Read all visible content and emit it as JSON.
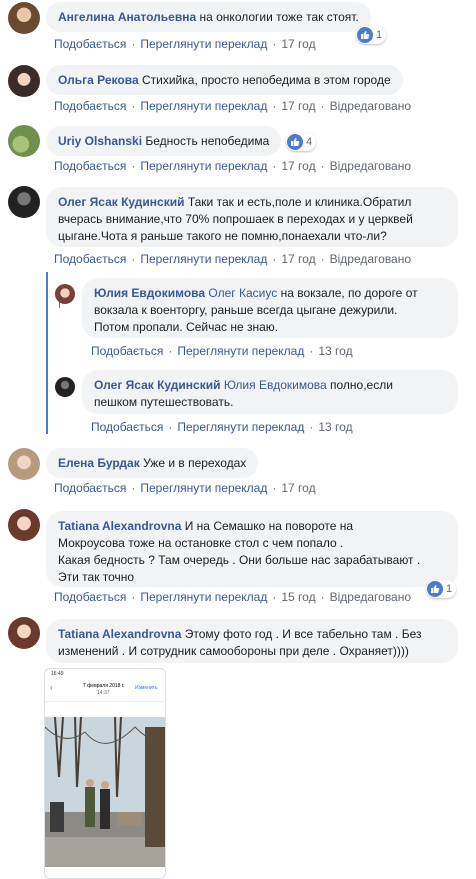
{
  "actions": {
    "like": "Подобається",
    "translate": "Переглянути переклад",
    "edited": "Відредаговано"
  },
  "colors": {
    "link": "#385898",
    "bubble": "#f2f3f5",
    "like": "#4a7bd1"
  },
  "comments": [
    {
      "author": "Ангелина Анатольевна",
      "text": "на онкологии тоже так стоят.",
      "time": "17 год",
      "reactions": "1"
    },
    {
      "author": "Ольга Рекова",
      "text": "Стихийка, просто непобедима в этом городе",
      "time": "17 год",
      "edited": true
    },
    {
      "author": "Uriy Olshanski",
      "text": "Бедность непобедима",
      "time": "17 год",
      "reactions": "4",
      "edited": true
    },
    {
      "author": "Олег Ясак Кудинский",
      "text_lines": [
        "Таки так и есть,поле и клиника.Обратил",
        "вчерась внимание,что 70% попрошаек в переходах и у церквей",
        "цыгане.Чота я раньше такого не помню,понаехали что-ли?"
      ],
      "time": "17 год",
      "edited": true
    },
    {
      "author": "Елена Бурдак",
      "text": "Уже и в переходах",
      "time": "17 год"
    },
    {
      "author": "Tatiana Alexandrovna",
      "text_lines": [
        "И на Семашко на повороте на",
        "Мокроусова тоже на остановке стол с чем попало .",
        "Какая бедность ? Там очередь . Они больше нас зарабатывают .",
        "Эти так точно"
      ],
      "time": "15 год",
      "reactions": "1",
      "edited": true
    },
    {
      "author": "Tatiana Alexandrovna",
      "text_lines": [
        "Этому фото год . И все табельно там . Без",
        "изменений . И сотрудник самообороны при деле . Охраняет))))"
      ]
    }
  ],
  "replies": [
    {
      "author": "Юлия Евдокимова",
      "mention": "Олег Касиус",
      "text_lines": [
        " на вокзале, по дороге от",
        "вокзала к военторгу, раньше всегда цыгане дежурили.",
        "Потом пропали. Сейчас не знаю."
      ],
      "time": "13 год"
    },
    {
      "author": "Олег Ясак Кудинский",
      "mention": "Юлия Евдокимова",
      "text_lines": [
        " полно,если",
        "пешком путешествовать."
      ],
      "time": "13 год"
    }
  ],
  "photo": {
    "status_time": "16:49",
    "date": "7 февраля 2018 г.",
    "date_time": "14:37",
    "edit_label": "Изменить"
  }
}
